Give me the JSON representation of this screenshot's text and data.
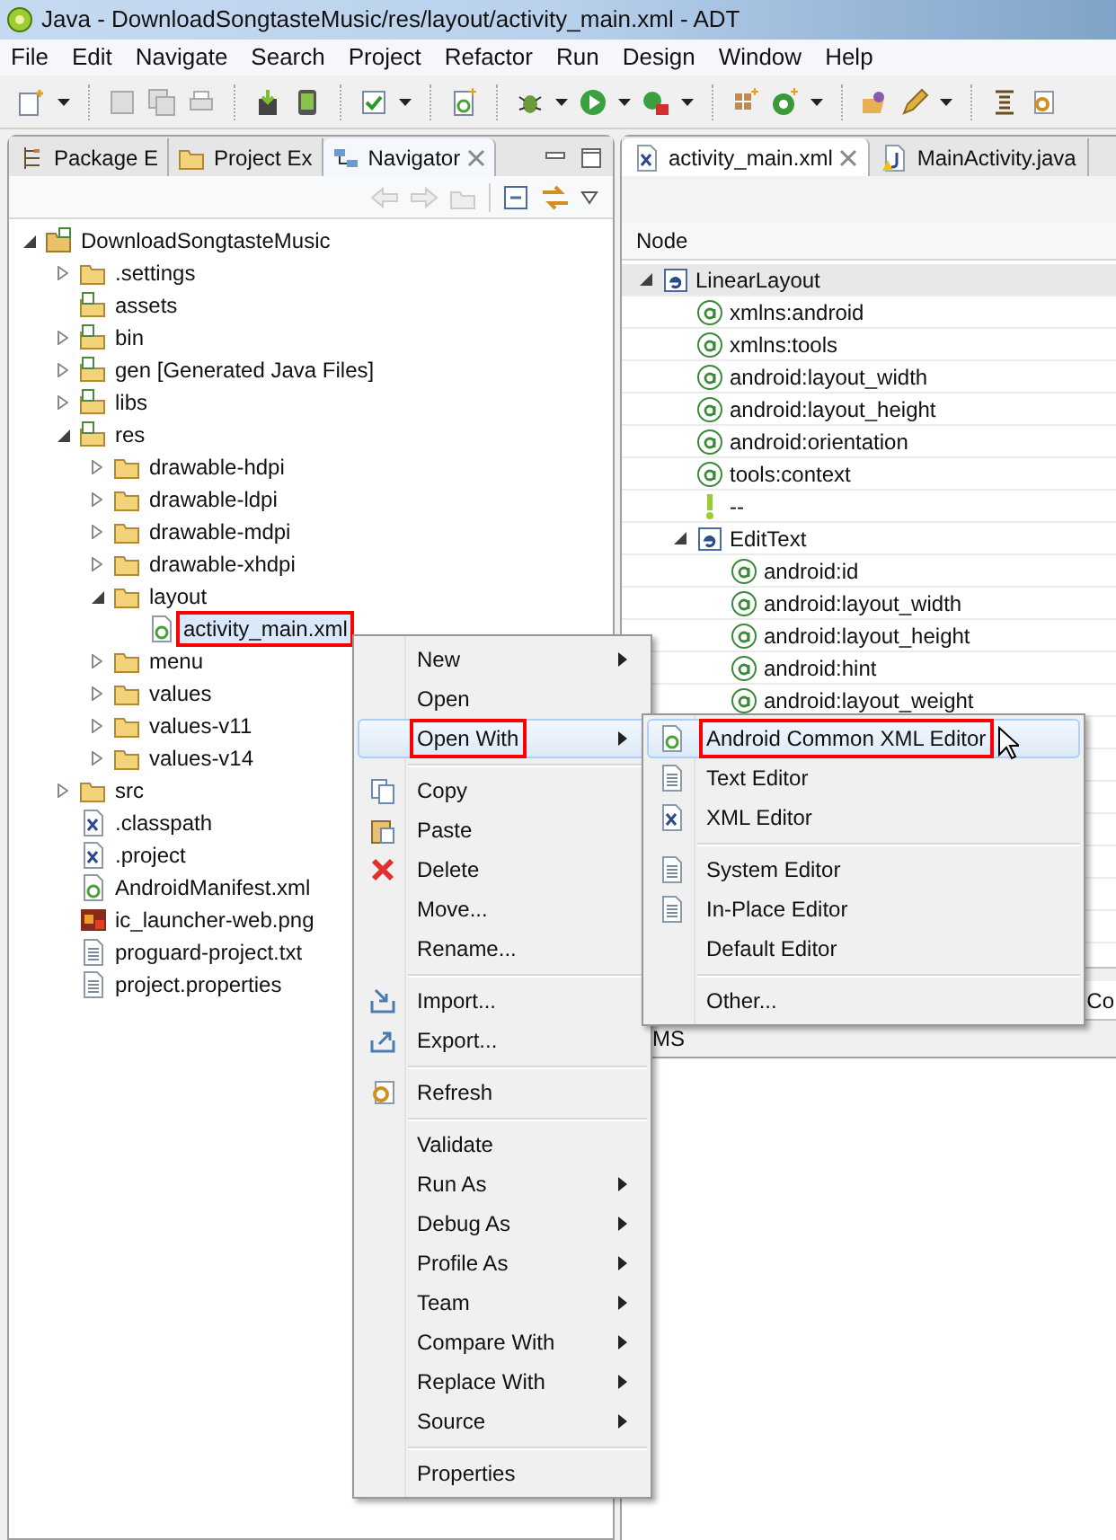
{
  "window": {
    "title": "Java - DownloadSongtasteMusic/res/layout/activity_main.xml - ADT"
  },
  "menu_bar": [
    "File",
    "Edit",
    "Navigate",
    "Search",
    "Project",
    "Refactor",
    "Run",
    "Design",
    "Window",
    "Help"
  ],
  "left_panel": {
    "tabs": [
      {
        "label": "Package E",
        "kind": "package",
        "selected": false
      },
      {
        "label": "Project Ex",
        "kind": "project",
        "selected": false
      },
      {
        "label": "Navigator",
        "kind": "navigator",
        "selected": true
      }
    ],
    "tree": [
      {
        "label": "DownloadSongtasteMusic",
        "kind": "project",
        "expanded": true,
        "selected": false,
        "marked": false,
        "children": [
          {
            "label": ".settings",
            "kind": "folder",
            "expanded": false,
            "selected": false,
            "marked": false
          },
          {
            "label": "assets",
            "kind": "source",
            "selected": false,
            "marked": false
          },
          {
            "label": "bin",
            "kind": "source",
            "expanded": false,
            "selected": false,
            "marked": false
          },
          {
            "label": "gen [Generated Java Files]",
            "kind": "source",
            "expanded": false,
            "selected": false,
            "marked": false
          },
          {
            "label": "libs",
            "kind": "source",
            "expanded": false,
            "selected": false,
            "marked": false
          },
          {
            "label": "res",
            "kind": "source",
            "expanded": true,
            "selected": false,
            "marked": false,
            "children": [
              {
                "label": "drawable-hdpi",
                "kind": "folder",
                "expanded": false,
                "selected": false,
                "marked": false
              },
              {
                "label": "drawable-ldpi",
                "kind": "folder",
                "expanded": false,
                "selected": false,
                "marked": false
              },
              {
                "label": "drawable-mdpi",
                "kind": "folder",
                "expanded": false,
                "selected": false,
                "marked": false
              },
              {
                "label": "drawable-xhdpi",
                "kind": "folder",
                "expanded": false,
                "selected": false,
                "marked": false
              },
              {
                "label": "layout",
                "kind": "folder",
                "expanded": true,
                "selected": false,
                "marked": false,
                "children": [
                  {
                    "label": "activity_main.xml",
                    "kind": "android",
                    "selected": true,
                    "marked": true
                  }
                ]
              },
              {
                "label": "menu",
                "kind": "folder",
                "expanded": false,
                "selected": false,
                "marked": false
              },
              {
                "label": "values",
                "kind": "folder",
                "expanded": false,
                "selected": false,
                "marked": false
              },
              {
                "label": "values-v11",
                "kind": "folder",
                "expanded": false,
                "selected": false,
                "marked": false
              },
              {
                "label": "values-v14",
                "kind": "folder",
                "expanded": false,
                "selected": false,
                "marked": false
              }
            ]
          },
          {
            "label": "src",
            "kind": "folder",
            "expanded": false,
            "selected": false,
            "marked": false
          },
          {
            "label": ".classpath",
            "kind": "xml",
            "selected": false,
            "marked": false
          },
          {
            "label": ".project",
            "kind": "xml",
            "selected": false,
            "marked": false
          },
          {
            "label": "AndroidManifest.xml",
            "kind": "android",
            "selected": false,
            "marked": false
          },
          {
            "label": "ic_launcher-web.png",
            "kind": "image",
            "selected": false,
            "marked": false
          },
          {
            "label": "proguard-project.txt",
            "kind": "text",
            "selected": false,
            "marked": false
          },
          {
            "label": "project.properties",
            "kind": "text",
            "selected": false,
            "marked": false
          }
        ]
      }
    ]
  },
  "editor": {
    "tabs": [
      {
        "label": "activity_main.xml",
        "kind": "xml",
        "selected": true
      },
      {
        "label": "MainActivity.java",
        "kind": "java",
        "selected": false
      }
    ],
    "column_header": "Node",
    "nodes": [
      {
        "label": "LinearLayout",
        "kind": "element",
        "expanded": true,
        "selected": true,
        "children": [
          {
            "label": "xmlns:android",
            "kind": "attribute",
            "selected": false
          },
          {
            "label": "xmlns:tools",
            "kind": "attribute",
            "selected": false
          },
          {
            "label": "android:layout_width",
            "kind": "attribute",
            "selected": false
          },
          {
            "label": "android:layout_height",
            "kind": "attribute",
            "selected": false
          },
          {
            "label": "android:orientation",
            "kind": "attribute",
            "selected": false
          },
          {
            "label": "tools:context",
            "kind": "attribute",
            "selected": false
          },
          {
            "label": "--",
            "kind": "comment",
            "selected": false
          },
          {
            "label": "EditText",
            "kind": "element",
            "expanded": true,
            "selected": false,
            "children": [
              {
                "label": "android:id",
                "kind": "attribute",
                "selected": false
              },
              {
                "label": "android:layout_width",
                "kind": "attribute",
                "selected": false
              },
              {
                "label": "android:layout_height",
                "kind": "attribute",
                "selected": false
              },
              {
                "label": "android:hint",
                "kind": "attribute",
                "selected": false
              },
              {
                "label": "android:layout_weight",
                "kind": "attribute",
                "selected": false
              }
            ]
          }
        ]
      }
    ],
    "cell_text": "Co",
    "bottom_tab": "MS"
  },
  "context_menu": {
    "groups": [
      [
        {
          "label": "New",
          "kind": "plain",
          "submenu": true,
          "selected": false,
          "marked": false
        },
        {
          "label": "Open",
          "kind": "plain",
          "submenu": false,
          "selected": false,
          "marked": false
        },
        {
          "label": "Open With",
          "kind": "plain",
          "submenu": true,
          "selected": true,
          "marked": true
        }
      ],
      [
        {
          "label": "Copy",
          "kind": "copy",
          "submenu": false,
          "selected": false,
          "marked": false
        },
        {
          "label": "Paste",
          "kind": "paste",
          "submenu": false,
          "selected": false,
          "marked": false
        },
        {
          "label": "Delete",
          "kind": "delete",
          "submenu": false,
          "selected": false,
          "marked": false
        },
        {
          "label": "Move...",
          "kind": "plain",
          "submenu": false,
          "selected": false,
          "marked": false
        },
        {
          "label": "Rename...",
          "kind": "plain",
          "submenu": false,
          "selected": false,
          "marked": false
        }
      ],
      [
        {
          "label": "Import...",
          "kind": "import",
          "submenu": false,
          "selected": false,
          "marked": false
        },
        {
          "label": "Export...",
          "kind": "export",
          "submenu": false,
          "selected": false,
          "marked": false
        }
      ],
      [
        {
          "label": "Refresh",
          "kind": "refresh",
          "submenu": false,
          "selected": false,
          "marked": false
        }
      ],
      [
        {
          "label": "Validate",
          "kind": "plain",
          "submenu": false,
          "selected": false,
          "marked": false
        },
        {
          "label": "Run As",
          "kind": "plain",
          "submenu": true,
          "selected": false,
          "marked": false
        },
        {
          "label": "Debug As",
          "kind": "plain",
          "submenu": true,
          "selected": false,
          "marked": false
        },
        {
          "label": "Profile As",
          "kind": "plain",
          "submenu": true,
          "selected": false,
          "marked": false
        },
        {
          "label": "Team",
          "kind": "plain",
          "submenu": true,
          "selected": false,
          "marked": false
        },
        {
          "label": "Compare With",
          "kind": "plain",
          "submenu": true,
          "selected": false,
          "marked": false
        },
        {
          "label": "Replace With",
          "kind": "plain",
          "submenu": true,
          "selected": false,
          "marked": false
        },
        {
          "label": "Source",
          "kind": "plain",
          "submenu": true,
          "selected": false,
          "marked": false
        }
      ],
      [
        {
          "label": "Properties",
          "kind": "plain",
          "submenu": false,
          "selected": false,
          "marked": false
        }
      ]
    ]
  },
  "submenu": {
    "groups": [
      [
        {
          "label": "Android Common XML Editor",
          "kind": "android",
          "selected": true,
          "marked": true
        },
        {
          "label": "Text Editor",
          "kind": "text",
          "selected": false,
          "marked": false
        },
        {
          "label": "XML Editor",
          "kind": "xml",
          "selected": false,
          "marked": false
        }
      ],
      [
        {
          "label": "System Editor",
          "kind": "text",
          "selected": false,
          "marked": false
        },
        {
          "label": "In-Place Editor",
          "kind": "text",
          "selected": false,
          "marked": false
        },
        {
          "label": "Default Editor",
          "kind": "plain",
          "selected": false,
          "marked": false
        }
      ],
      [
        {
          "label": "Other...",
          "kind": "plain",
          "selected": false,
          "marked": false
        }
      ]
    ]
  }
}
